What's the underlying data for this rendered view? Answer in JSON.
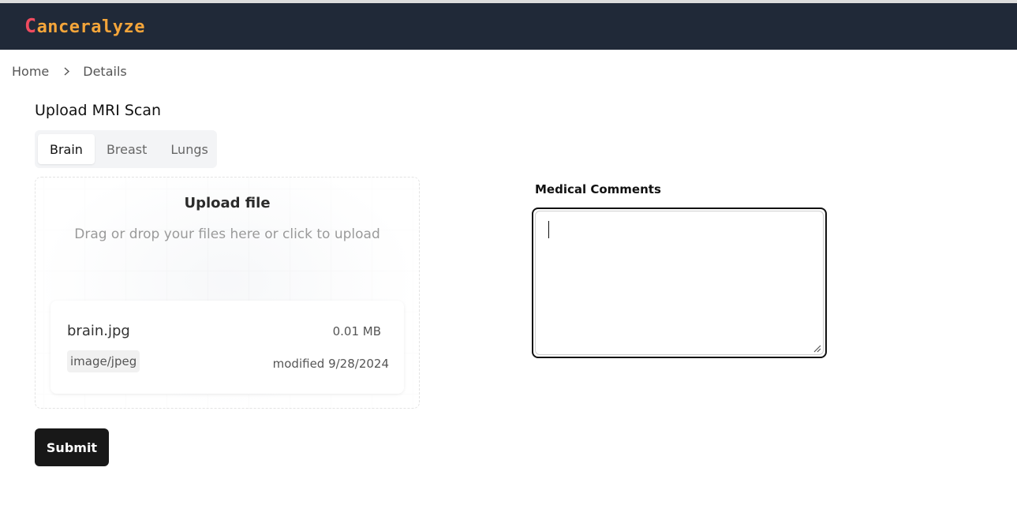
{
  "app": {
    "logo_first_letter": "C",
    "logo_rest": "anceralyze",
    "colors": {
      "navbar": "#202938",
      "logo_c": "#ef4b5f",
      "logo_text": "#f4a53a",
      "button": "#181818"
    }
  },
  "breadcrumb": {
    "home": "Home",
    "current": "Details",
    "separator_icon": "chevron-right-icon"
  },
  "page": {
    "title": "Upload MRI Scan"
  },
  "tabs": [
    {
      "label": "Brain",
      "active": true
    },
    {
      "label": "Breast",
      "active": false
    },
    {
      "label": "Lungs",
      "active": false
    }
  ],
  "upload": {
    "title": "Upload file",
    "hint": "Drag or drop your files here or click to upload"
  },
  "file": {
    "name": "brain.jpg",
    "size": "0.01 MB",
    "type": "image/jpeg",
    "modified": "modified 9/28/2024"
  },
  "comments": {
    "label": "Medical Comments",
    "value": "",
    "placeholder": ""
  },
  "actions": {
    "submit_label": "Submit"
  }
}
